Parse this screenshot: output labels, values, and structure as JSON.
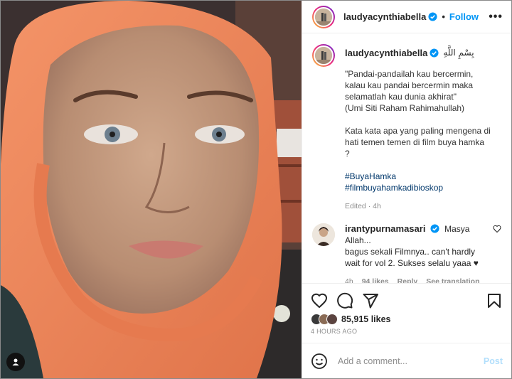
{
  "post": {
    "username": "laudyacynthiabella",
    "follow_label": "Follow",
    "more_label": "•••",
    "separator": "•"
  },
  "caption": {
    "username": "laudyacynthiabella",
    "arabic": "بِسْمِ اللَّهِ",
    "quote_lines": [
      "\"Pandai-pandailah kau bercermin,",
      "kalau kau pandai bercermin maka",
      "selamatlah kau dunia akhirat\"",
      "(Umi Siti Raham Rahimahullah)"
    ],
    "question_lines": [
      "Kata kata apa yang paling mengena di",
      "hati temen temen di film buya hamka",
      "?"
    ],
    "hashtags": [
      "#BuyaHamka",
      "#filmbuyahamkadibioskop"
    ],
    "edited": "Edited · 4h"
  },
  "comment": {
    "username": "irantypurnamasari",
    "text_first": "Masya Allah...",
    "text_rest": "bagus sekali Filmnya.. can't hardly wait for vol 2. Sukses selalu yaaa ♥",
    "time": "4h",
    "likes": "94 likes",
    "reply": "Reply",
    "see_translation": "See translation"
  },
  "likes": {
    "count": "85,915 likes",
    "time_ago": "4 HOURS AGO"
  },
  "add_comment": {
    "placeholder": "Add a comment...",
    "post_label": "Post"
  },
  "icons": {
    "verified": "verified-badge-icon",
    "like": "heart-icon",
    "comment": "comment-bubble-icon",
    "share": "paper-plane-icon",
    "save": "bookmark-icon",
    "emoji": "smiley-icon",
    "tag": "user-tag-icon"
  },
  "colors": {
    "accent": "#0095f6",
    "hashtag": "#00376b",
    "muted": "#8e8e8e",
    "hijab": "#f08a5d"
  }
}
